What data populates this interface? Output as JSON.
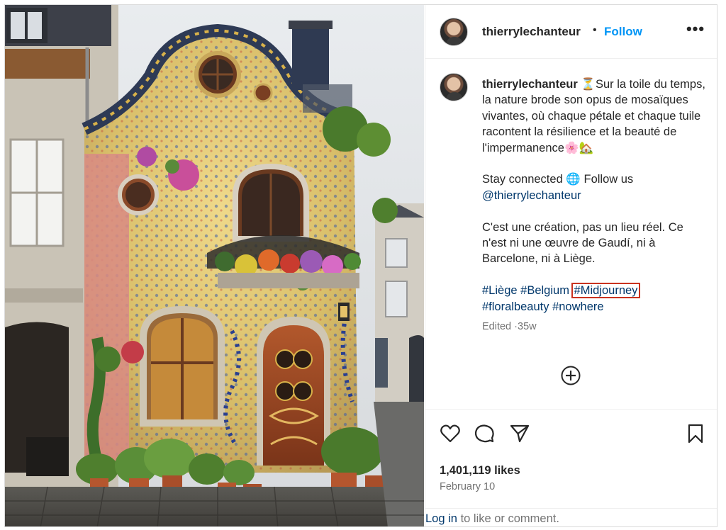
{
  "post": {
    "username": "thierrylechanteur",
    "separator": "•",
    "follow_label": "Follow",
    "more_icon": "more-options-icon",
    "image_alt": "Mosaic fairytale house facade covered in flowers"
  },
  "caption": {
    "username": "thierrylechanteur",
    "hourglass": "⏳",
    "text1": "Sur la toile du temps, la nature brode son opus de mosaïques vivantes, où chaque pétale et chaque tuile racontent la résilience et la beauté de l'impermanence",
    "emoji_end": "🌸🏡",
    "stay_connected": "Stay connected",
    "globe": "🌐",
    "follow_us": "Follow us",
    "mention": "@thierrylechanteur",
    "note": "C'est une création, pas un lieu réel. Ce n'est ni une œuvre de Gaudí, ni à Barcelone, ni à Liège.",
    "hashtags": [
      "#Liège",
      "#Belgium",
      "#Midjourney",
      "#floralbeauty",
      "#nowhere"
    ],
    "highlighted_hashtag": "#Midjourney",
    "edited": "Edited",
    "meta_sep": "·",
    "age": "35w"
  },
  "actions": {
    "likes": "1,401,119 likes",
    "date": "February 10",
    "login_link": "Log in",
    "login_rest": "to like or comment."
  },
  "colors": {
    "accent_blue": "#0095f6",
    "link_blue": "#00376b",
    "highlight_box": "#c9321f",
    "muted": "#737373"
  }
}
